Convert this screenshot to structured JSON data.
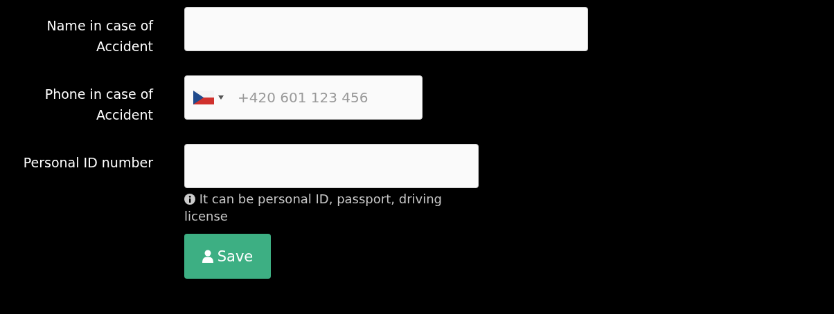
{
  "fields": [
    {
      "kind": "text",
      "label": "Name in case of Accident"
    },
    {
      "kind": "phone",
      "label": "Phone in case of Accident",
      "placeholder": "+420 601 123 456"
    },
    {
      "kind": "text",
      "label": "Personal ID number",
      "help": "It can be personal ID, passport, driving license"
    }
  ],
  "save_button": {
    "label": "Save"
  }
}
